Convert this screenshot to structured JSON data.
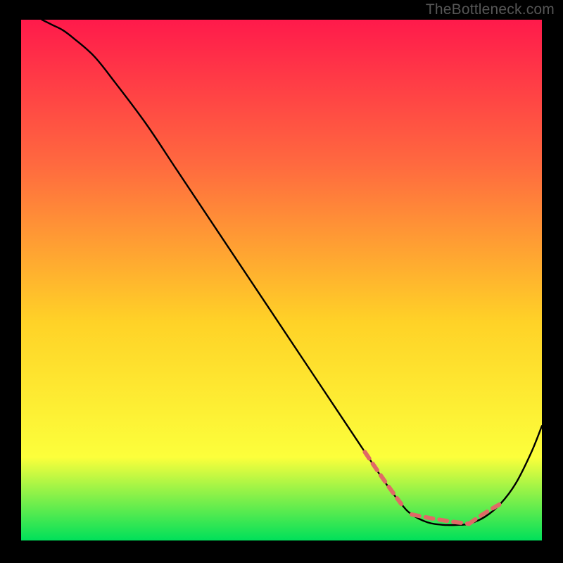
{
  "watermark": "TheBottleneck.com",
  "chart_data": {
    "type": "line",
    "title": "",
    "xlabel": "",
    "ylabel": "",
    "xlim": [
      0,
      100
    ],
    "ylim": [
      0,
      100
    ],
    "background_gradient": {
      "top_color": "#ff1a4b",
      "upper_color": "#ff6a3f",
      "mid_color": "#ffd227",
      "lower_color": "#fcff3b",
      "bottom_color": "#00e05a"
    },
    "series": [
      {
        "name": "bottleneck-curve",
        "x": [
          4,
          6,
          8,
          10,
          14,
          18,
          24,
          30,
          38,
          46,
          54,
          60,
          66,
          70,
          73,
          75,
          78,
          81,
          84,
          86,
          89,
          92,
          95,
          98,
          100
        ],
        "y": [
          100,
          99,
          98,
          96.5,
          93,
          88,
          80,
          71,
          59,
          47,
          35,
          26,
          17,
          11,
          7,
          5,
          3.5,
          3,
          3,
          3.2,
          4.5,
          7,
          11,
          17,
          22
        ]
      }
    ],
    "dash_spans": [
      {
        "x": [
          66,
          73
        ],
        "y": [
          17,
          7
        ]
      },
      {
        "x": [
          75,
          86
        ],
        "y": [
          5,
          3.2
        ]
      },
      {
        "x": [
          86,
          92
        ],
        "y": [
          3.2,
          7
        ]
      }
    ],
    "curve_color": "#000000",
    "dash_color": "#e06a66"
  }
}
